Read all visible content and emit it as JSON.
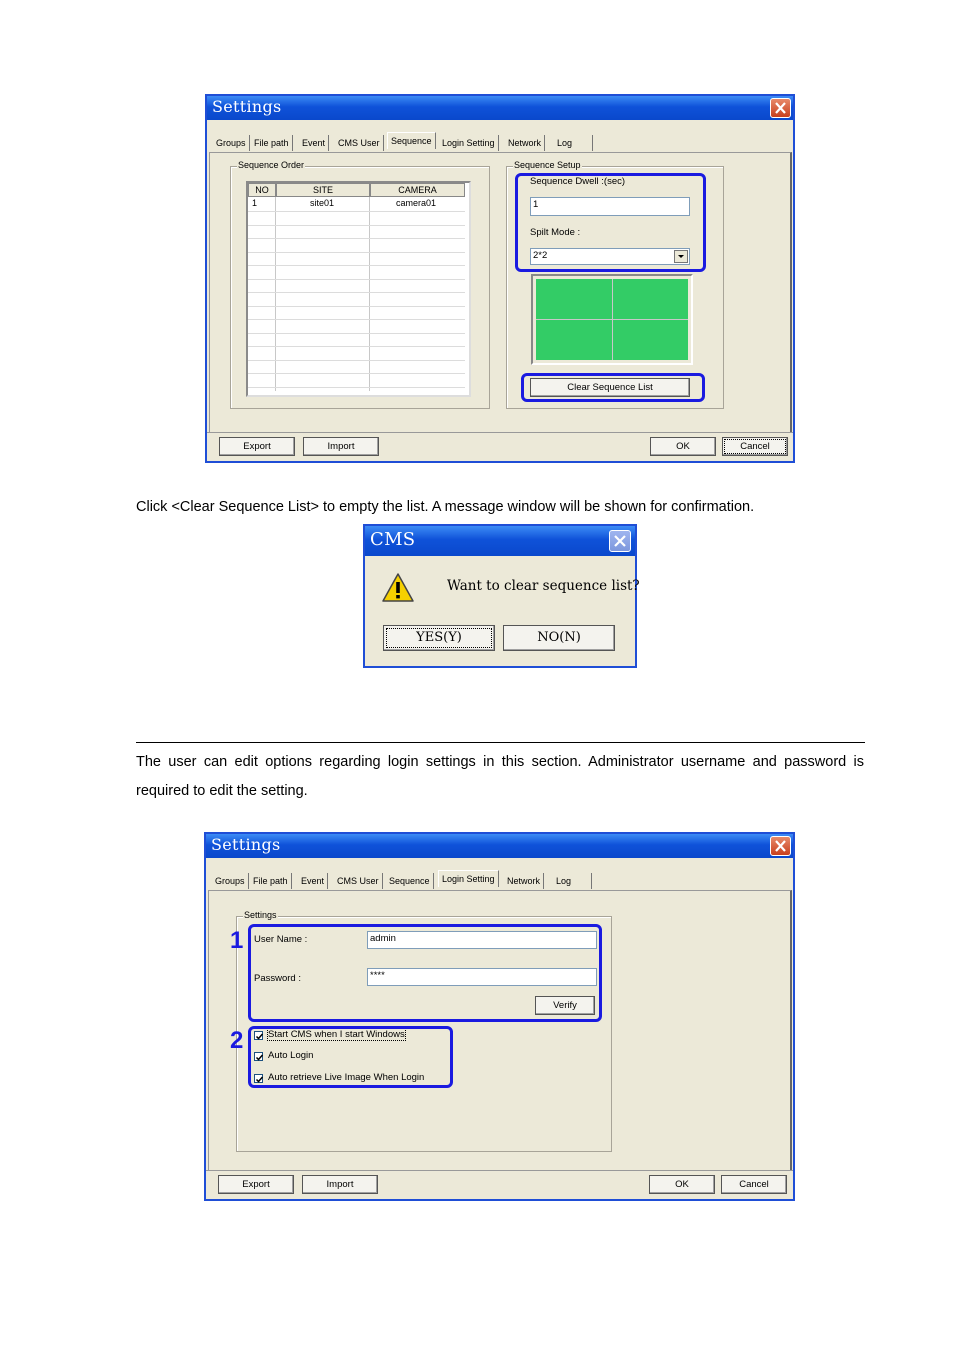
{
  "dialog1": {
    "title": "Settings",
    "tabs": [
      "Groups",
      "File path",
      "Event",
      "CMS User",
      "Sequence",
      "Login Setting",
      "Network",
      "Log"
    ],
    "active_tab": "Sequence",
    "sequence_order_legend": "Sequence Order",
    "table_headers": [
      "NO",
      "SITE",
      "CAMERA"
    ],
    "table_rows": [
      [
        "1",
        "site01",
        "camera01"
      ]
    ],
    "sequence_setup_legend": "Sequence Setup",
    "dwell_label": "Sequence Dwell :(sec)",
    "dwell_value": "1",
    "split_label": "Spilt Mode :",
    "split_value": "2*2",
    "clear_button": "Clear Sequence List",
    "export_button": "Export",
    "import_button": "Import",
    "ok_button": "OK",
    "cancel_button": "Cancel",
    "preview_color": "#33cc66"
  },
  "instruction_text": "Click <Clear Sequence List> to empty the list. A message window will be shown for confirmation.",
  "cms_dialog": {
    "title": "CMS",
    "message": "Want to clear sequence list?",
    "yes_button": "YES(Y)",
    "no_button": "NO(N)"
  },
  "login_text": "The user can edit options regarding login settings in this section. Administrator username and password is required to edit the setting.",
  "dialog2": {
    "title": "Settings",
    "tabs": [
      "Groups",
      "File path",
      "Event",
      "CMS User",
      "Sequence",
      "Login Setting",
      "Network",
      "Log"
    ],
    "active_tab": "Login Setting",
    "settings_legend": "Settings",
    "username_label": "User Name :",
    "username_value": "admin",
    "password_label": "Password :",
    "password_value": "****",
    "verify_button": "Verify",
    "marker1": "1",
    "marker2": "2",
    "checkboxes": [
      {
        "label": "Start CMS when I start Windows",
        "checked": true
      },
      {
        "label": "Auto Login",
        "checked": true
      },
      {
        "label": "Auto retrieve Live Image When Login",
        "checked": true
      }
    ],
    "export_button": "Export",
    "import_button": "Import",
    "ok_button": "OK",
    "cancel_button": "Cancel"
  }
}
